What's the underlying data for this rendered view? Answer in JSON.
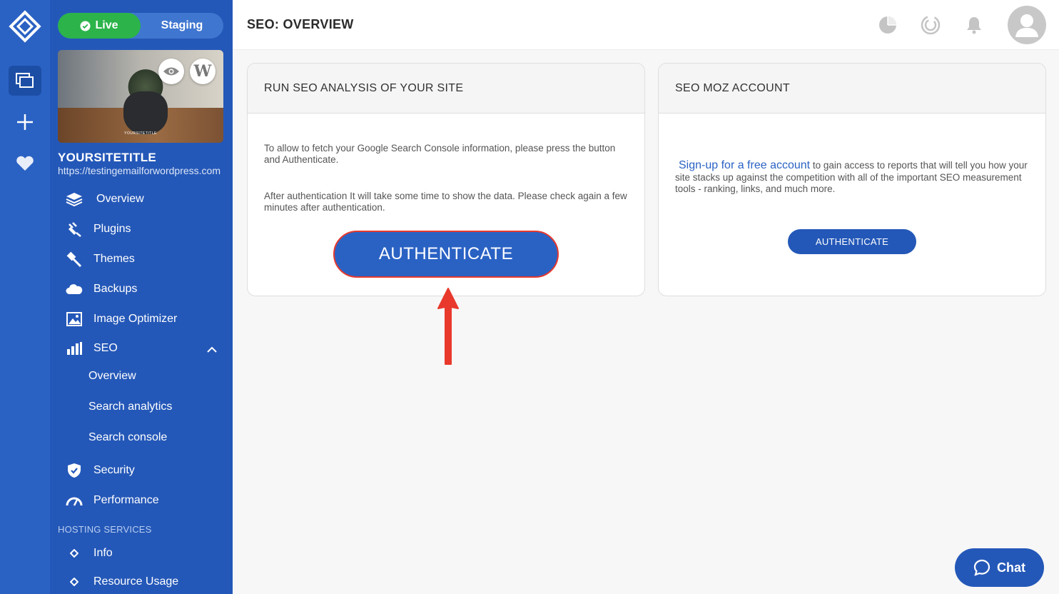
{
  "env": {
    "live_label": "Live",
    "staging_label": "Staging"
  },
  "site": {
    "thumb_caption": "YOURSITETITLE",
    "title": "YOURSITETITLE",
    "url": "https://testingemailforwordpress.com"
  },
  "nav": {
    "overview": "Overview",
    "plugins": "Plugins",
    "themes": "Themes",
    "backups": "Backups",
    "image_optimizer": "Image Optimizer",
    "seo": "SEO",
    "seo_sub": [
      "Overview",
      "Search analytics",
      "Search console"
    ],
    "security": "Security",
    "performance": "Performance",
    "hosting_label": "HOSTING SERVICES",
    "info": "Info",
    "resource_usage": "Resource Usage"
  },
  "header": {
    "title": "SEO: OVERVIEW"
  },
  "card_seo": {
    "title": "RUN SEO ANALYSIS OF YOUR SITE",
    "p1": "To allow to fetch your Google Search Console information, please press the button and Authenticate.",
    "p2": "After authentication It will take some time to show the data. Please check again a few minutes after authentication.",
    "button": "AUTHENTICATE"
  },
  "card_moz": {
    "title": "SEO MOZ ACCOUNT",
    "link": "Sign-up for a free account",
    "text_after_link": " to gain access to reports that will tell you how your site stacks up against the competition with all of the important SEO measurement tools - ranking, links, and much more.",
    "button": "AUTHENTICATE"
  },
  "chat": {
    "label": "Chat"
  },
  "colors": {
    "primary": "#2a62c4",
    "sidebar": "#2458b8",
    "live": "#2cb34a",
    "highlight": "#e53a2e"
  }
}
